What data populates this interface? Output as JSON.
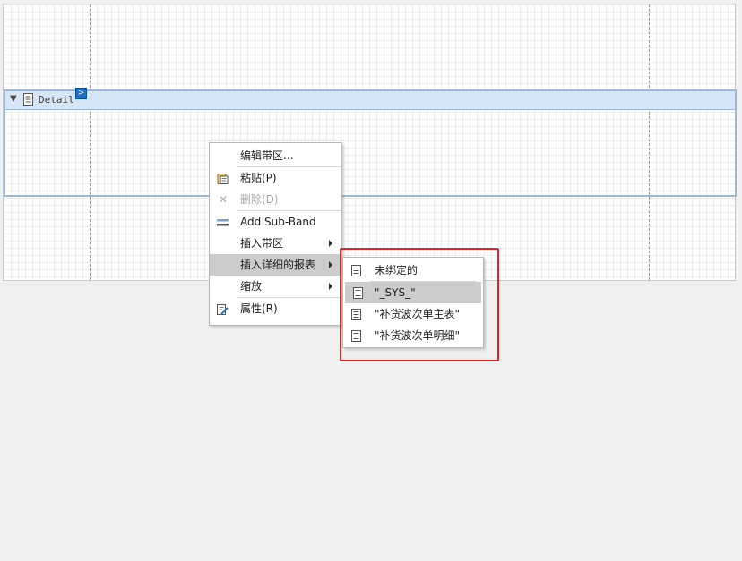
{
  "band": {
    "label": "Detail",
    "smart_tag": ">"
  },
  "context_menu": {
    "items": [
      {
        "label": "编辑带区..."
      },
      {
        "label": "粘贴(P)"
      },
      {
        "label": "删除(D)"
      },
      {
        "label": "Add Sub-Band"
      },
      {
        "label": "插入带区"
      },
      {
        "label": "插入详细的报表"
      },
      {
        "label": "缩放"
      },
      {
        "label": "属性(R)"
      }
    ]
  },
  "submenu": {
    "items": [
      {
        "label": "未绑定的"
      },
      {
        "label": "\"_SYS_\""
      },
      {
        "label": "\"补货波次单主表\""
      },
      {
        "label": "\"补货波次单明细\""
      }
    ]
  },
  "colors": {
    "highlight": "#cccccc",
    "annotation": "#e02424",
    "band_header": "#d7e6f7",
    "smart_tag": "#1f6fc5"
  }
}
